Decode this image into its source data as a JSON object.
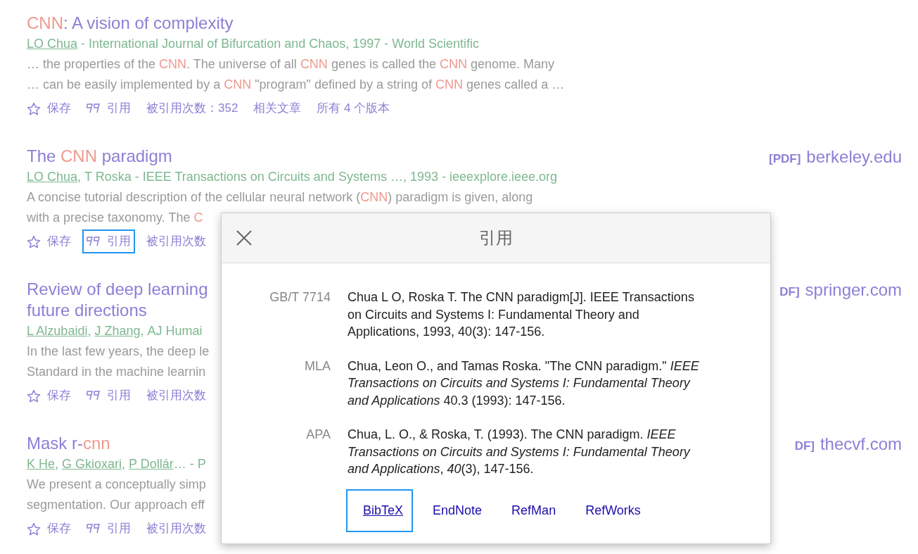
{
  "results": [
    {
      "title": [
        {
          "text": "CNN",
          "hl": true
        },
        {
          "text": ": A vision of complexity",
          "hl": false
        }
      ],
      "byline": [
        {
          "text": "LO Chua",
          "link": true
        },
        {
          "text": " - International Journal of Bifurcation and Chaos, 1997 - World Scientific",
          "link": false
        }
      ],
      "snippet": [
        [
          {
            "text": "… the properties of the ",
            "hl": false
          },
          {
            "text": "CNN",
            "hl": true
          },
          {
            "text": ". The universe of all ",
            "hl": false
          },
          {
            "text": "CNN",
            "hl": true
          },
          {
            "text": " genes is called the ",
            "hl": false
          },
          {
            "text": "CNN",
            "hl": true
          },
          {
            "text": " genome. Many",
            "hl": false
          }
        ],
        [
          {
            "text": "… can be easily implemented by a ",
            "hl": false
          },
          {
            "text": "CNN",
            "hl": true
          },
          {
            "text": " \"program\" defined by a string of ",
            "hl": false
          },
          {
            "text": "CNN",
            "hl": true
          },
          {
            "text": " genes called a …",
            "hl": false
          }
        ]
      ],
      "actions": [
        {
          "kind": "save",
          "label": "保存",
          "focused": false
        },
        {
          "kind": "cite",
          "label": "引用",
          "focused": false
        },
        {
          "kind": "text",
          "label": "被引用次数：352",
          "focused": false
        },
        {
          "kind": "text",
          "label": "相关文章",
          "focused": false
        },
        {
          "kind": "text",
          "label": "所有 4 个版本",
          "focused": false
        }
      ]
    },
    {
      "title": [
        {
          "text": "The ",
          "hl": false
        },
        {
          "text": "CNN",
          "hl": true
        },
        {
          "text": " paradigm",
          "hl": false
        }
      ],
      "byline": [
        {
          "text": "LO Chua",
          "link": true,
          "sep": ", "
        },
        {
          "text": "T Roska - IEEE Transactions on Circuits and Systems …, 1993 - ieeexplore.ieee.org",
          "link": false
        }
      ],
      "snippet": [
        [
          {
            "text": "A concise tutorial description of the cellular neural network (",
            "hl": false
          },
          {
            "text": "CNN",
            "hl": true
          },
          {
            "text": ") paradigm is given, along",
            "hl": false
          }
        ],
        [
          {
            "text": "with a precise taxonomy. The ",
            "hl": false
          },
          {
            "text": "C",
            "hl": true
          }
        ]
      ],
      "actions": [
        {
          "kind": "save",
          "label": "保存",
          "focused": false
        },
        {
          "kind": "cite",
          "label": "引用",
          "focused": true
        },
        {
          "kind": "text",
          "label": "被引用次数",
          "focused": false
        }
      ],
      "pdf": {
        "tag": "[PDF]",
        "site": "berkeley.edu"
      }
    },
    {
      "title": [
        {
          "text": "Review of deep learning",
          "hl": false
        },
        {
          "text": "\nfuture directions",
          "hl": false
        }
      ],
      "byline": [
        {
          "text": "L Alzubaidi",
          "link": true,
          "sep": ", "
        },
        {
          "text": "J Zhang",
          "link": true,
          "sep": ", "
        },
        {
          "text": "AJ Humai",
          "link": false
        }
      ],
      "snippet": [
        [
          {
            "text": "In the last few years, the deep le",
            "hl": false
          }
        ],
        [
          {
            "text": "Standard in the machine learnin",
            "hl": false
          }
        ]
      ],
      "actions": [
        {
          "kind": "save",
          "label": "保存",
          "focused": false
        },
        {
          "kind": "cite",
          "label": "引用",
          "focused": false
        },
        {
          "kind": "text",
          "label": "被引用次数",
          "focused": false
        }
      ],
      "pdf": {
        "tag": "DF]",
        "site": "springer.com"
      }
    },
    {
      "title": [
        {
          "text": "Mask r-",
          "hl": false
        },
        {
          "text": "cnn",
          "hl": true
        }
      ],
      "byline": [
        {
          "text": "K He",
          "link": true,
          "sep": ", "
        },
        {
          "text": "G Gkioxari",
          "link": true,
          "sep": ", "
        },
        {
          "text": "P Dollár",
          "link": true
        },
        {
          "text": "… - P",
          "link": false
        }
      ],
      "snippet": [
        [
          {
            "text": "We present a conceptually simp",
            "hl": false
          }
        ],
        [
          {
            "text": "segmentation. Our approach eff",
            "hl": false
          }
        ]
      ],
      "actions": [
        {
          "kind": "save",
          "label": "保存",
          "focused": false
        },
        {
          "kind": "cite",
          "label": "引用",
          "focused": false
        },
        {
          "kind": "text",
          "label": "被引用次数",
          "focused": false
        }
      ],
      "pdf": {
        "tag": "DF]",
        "site": "thecvf.com"
      }
    }
  ],
  "dialog": {
    "title": "引用",
    "citations": [
      {
        "style": "GB/T 7714",
        "text": "Chua L O, Roska T. The CNN paradigm[J]. IEEE Transactions on Circuits and Systems I: Fundamental Theory and Applications, 1993, 40(3): 147-156."
      },
      {
        "style": "MLA",
        "text": "Chua, Leon O., and Tamas Roska. \"The CNN paradigm.\" *IEEE Transactions on Circuits and Systems I: Fundamental Theory and Applications* 40.3 (1993): 147-156."
      },
      {
        "style": "APA",
        "text": "Chua, L. O., & Roska, T. (1993). The CNN paradigm. *IEEE Transactions on Circuits and Systems I: Fundamental Theory and Applications*, *40*(3), 147-156."
      }
    ],
    "exports": [
      {
        "label": "BibTeX",
        "focused": true
      },
      {
        "label": "EndNote",
        "focused": false
      },
      {
        "label": "RefMan",
        "focused": false
      },
      {
        "label": "RefWorks",
        "focused": false
      }
    ]
  }
}
